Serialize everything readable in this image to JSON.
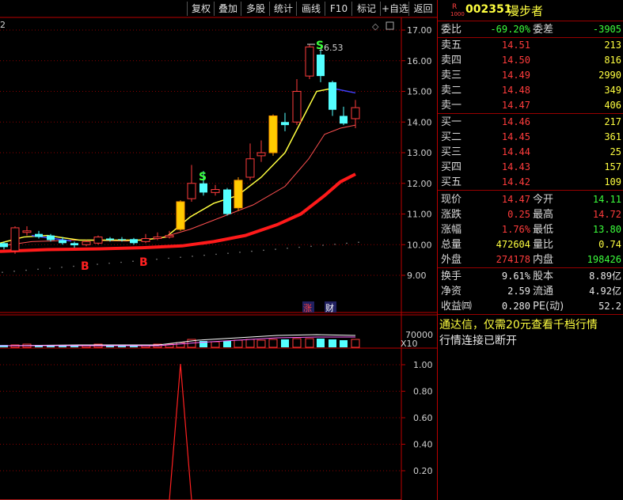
{
  "toolbar": {
    "items": [
      "复权",
      "叠加",
      "多股",
      "统计",
      "画线",
      "F10",
      "标记",
      "+自选",
      "返回"
    ]
  },
  "chart": {
    "top_left_marker": "2",
    "price_axis": [
      "17.00",
      "16.00",
      "15.00",
      "14.00",
      "13.00",
      "12.00",
      "11.00",
      "10.00",
      "9.00"
    ],
    "high_label": "16.53",
    "signals_s": [
      "S",
      "S"
    ],
    "signals_b": [
      "B",
      "B"
    ],
    "badges": [
      "涨",
      "财"
    ],
    "volume_axis_value": "70000",
    "volume_axis_unit": "X10",
    "indicator_axis": [
      "1.00",
      "0.80",
      "0.60",
      "0.40",
      "0.20"
    ],
    "colors": {
      "up": "#ff3c3c",
      "down": "#54ffff",
      "ma_short": "#ffff40",
      "ma_long": "#ff1a1a",
      "grid": "#8b0000"
    }
  },
  "quote": {
    "badge_top": "R",
    "badge_bottom": "1000",
    "code": "002351",
    "name": "漫步者",
    "weibi_label": "委比",
    "weibi_value": "-69.20%",
    "weicha_label": "委差",
    "weicha_value": "-3905",
    "asks": [
      {
        "label": "卖五",
        "price": "14.51",
        "vol": "213"
      },
      {
        "label": "卖四",
        "price": "14.50",
        "vol": "816"
      },
      {
        "label": "卖三",
        "price": "14.49",
        "vol": "2990"
      },
      {
        "label": "卖二",
        "price": "14.48",
        "vol": "349"
      },
      {
        "label": "卖一",
        "price": "14.47",
        "vol": "406"
      }
    ],
    "bids": [
      {
        "label": "买一",
        "price": "14.46",
        "vol": "217"
      },
      {
        "label": "买二",
        "price": "14.45",
        "vol": "361"
      },
      {
        "label": "买三",
        "price": "14.44",
        "vol": "25"
      },
      {
        "label": "买四",
        "price": "14.43",
        "vol": "157"
      },
      {
        "label": "买五",
        "price": "14.42",
        "vol": "109"
      }
    ],
    "stats": [
      {
        "l1": "现价",
        "v1": "14.47",
        "l2": "今开",
        "v2": "14.11"
      },
      {
        "l1": "涨跌",
        "v1": "0.25",
        "l2": "最高",
        "v2": "14.72"
      },
      {
        "l1": "涨幅",
        "v1": "1.76%",
        "l2": "最低",
        "v2": "13.80"
      },
      {
        "l1": "总量",
        "v1": "472604",
        "l2": "量比",
        "v2": "0.74"
      },
      {
        "l1": "外盘",
        "v1": "274178",
        "l2": "内盘",
        "v2": "198426"
      }
    ],
    "stats2": [
      {
        "l1": "换手",
        "v1": "9.61%",
        "l2": "股本",
        "v2": "8.89亿"
      },
      {
        "l1": "净资",
        "v1": "2.59",
        "l2": "流通",
        "v2": "4.92亿"
      },
      {
        "l1": "收益㈣",
        "v1": "0.280",
        "l2": "PE(动)",
        "v2": "52.2"
      }
    ],
    "promo": "通达信，仅需20元查看千档行情",
    "status": "行情连接已断开"
  }
}
